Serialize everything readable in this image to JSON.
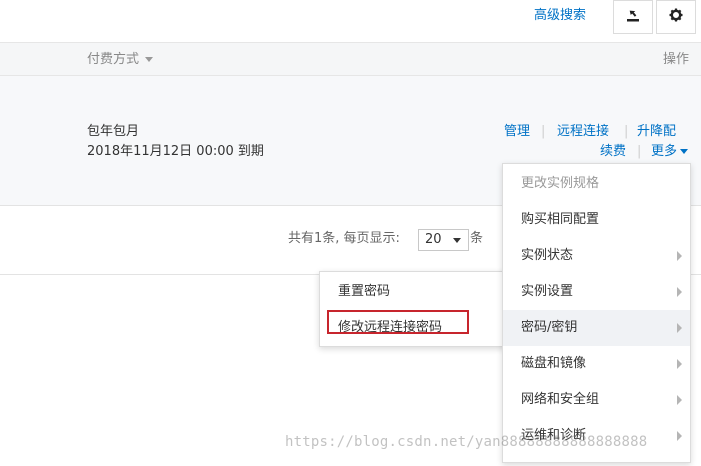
{
  "toolbar": {
    "advanced_search": "高级搜索",
    "download_icon": "download-icon",
    "settings_icon": "gear-icon"
  },
  "table": {
    "headers": {
      "payment_method": "付费方式",
      "operations": "操作"
    },
    "row": {
      "payment_type": "包年包月",
      "expiry": "2018年11月12日 00:00 到期",
      "actions": {
        "manage": "管理",
        "remote_connect": "远程连接",
        "upgrade": "升降配",
        "renew": "续费",
        "more": "更多"
      }
    }
  },
  "pagination": {
    "total_text": "共有1条, 每页显示:",
    "page_size": "20",
    "unit": "条"
  },
  "more_menu": {
    "items": [
      {
        "label": "更改实例规格",
        "disabled": true,
        "submenu": false
      },
      {
        "label": "购买相同配置",
        "disabled": false,
        "submenu": false
      },
      {
        "label": "实例状态",
        "disabled": false,
        "submenu": true
      },
      {
        "label": "实例设置",
        "disabled": false,
        "submenu": true
      },
      {
        "label": "密码/密钥",
        "disabled": false,
        "submenu": true,
        "active": true
      },
      {
        "label": "磁盘和镜像",
        "disabled": false,
        "submenu": true
      },
      {
        "label": "网络和安全组",
        "disabled": false,
        "submenu": true
      },
      {
        "label": "运维和诊断",
        "disabled": false,
        "submenu": true
      }
    ]
  },
  "password_submenu": {
    "items": [
      {
        "label": "重置密码"
      },
      {
        "label": "修改远程连接密码",
        "highlighted": true
      }
    ]
  },
  "watermark": "https://blog.csdn.net/yan88888888888888888",
  "colors": {
    "link": "#0072c6",
    "highlight_border": "#c7252d"
  }
}
